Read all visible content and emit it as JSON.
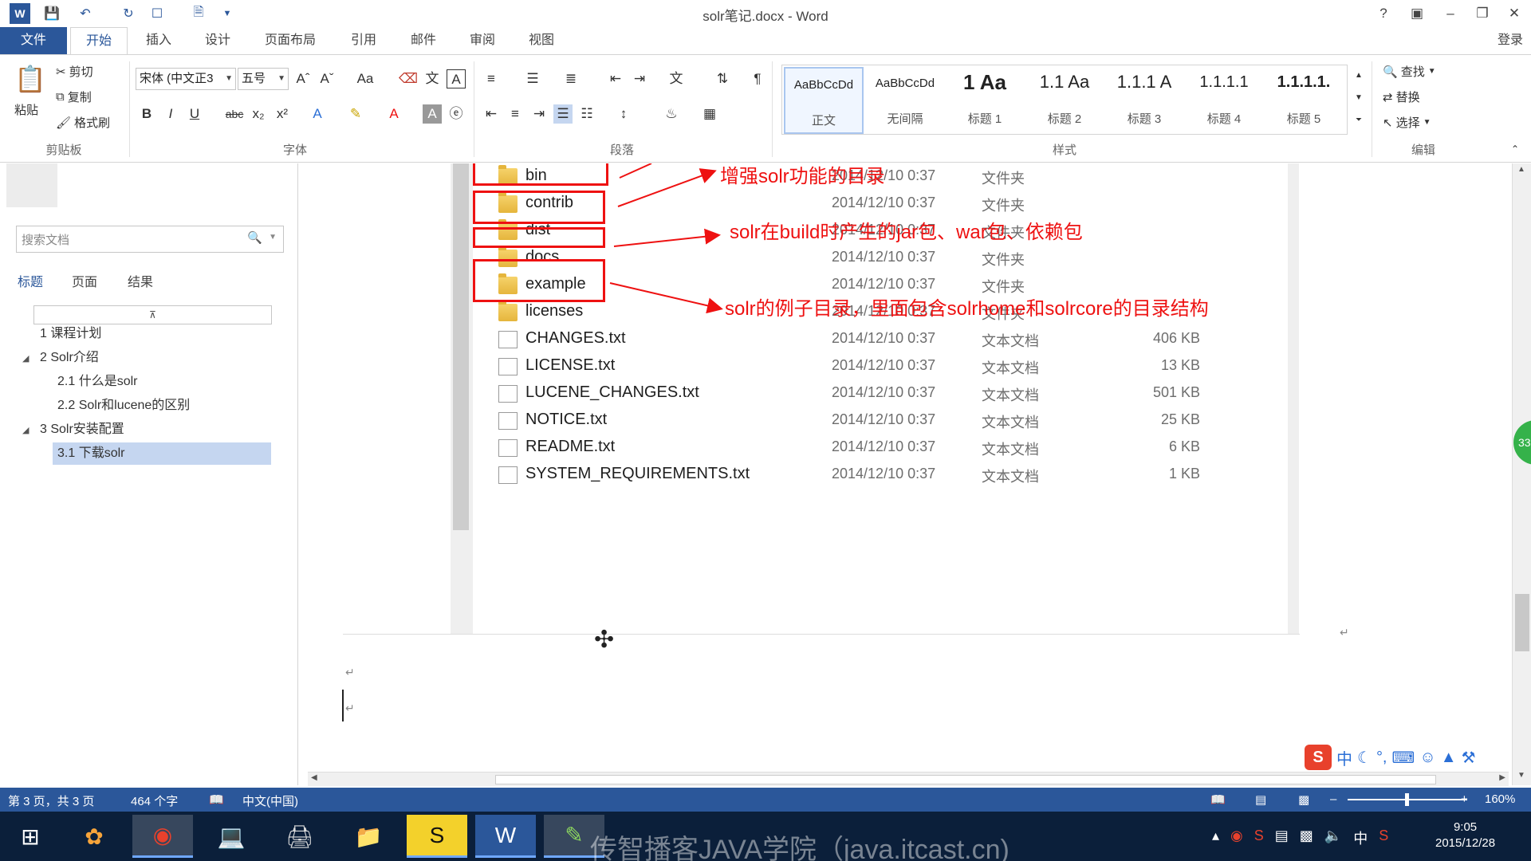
{
  "window": {
    "title": "solr笔记.docx - Word",
    "help": "?",
    "login": "登录"
  },
  "tabs": [
    {
      "label": "文件"
    },
    {
      "label": "开始"
    },
    {
      "label": "插入"
    },
    {
      "label": "设计"
    },
    {
      "label": "页面布局"
    },
    {
      "label": "引用"
    },
    {
      "label": "邮件"
    },
    {
      "label": "审阅"
    },
    {
      "label": "视图"
    }
  ],
  "ribbon": {
    "clipboard": {
      "paste": "粘贴",
      "cut": "剪切",
      "copy": "复制",
      "format_painter": "格式刷",
      "group": "剪贴板"
    },
    "font": {
      "name": "宋体 (中文正3",
      "size": "五号",
      "group": "字体"
    },
    "paragraph": {
      "group": "段落"
    },
    "styles": {
      "group": "样式",
      "items": [
        {
          "sample": "AaBbCcDd",
          "name": "正文"
        },
        {
          "sample": "AaBbCcDd",
          "name": "无间隔"
        },
        {
          "sample": "1  Aa",
          "name": "标题 1"
        },
        {
          "sample": "1.1  Aa",
          "name": "标题 2"
        },
        {
          "sample": "1.1.1 A",
          "name": "标题 3"
        },
        {
          "sample": "1.1.1.1",
          "name": "标题 4"
        },
        {
          "sample": "1.1.1.1.",
          "name": "标题 5"
        }
      ]
    },
    "editing": {
      "find": "查找",
      "replace": "替换",
      "select": "选择",
      "group": "编辑"
    }
  },
  "nav": {
    "search_placeholder": "搜索文档",
    "tabs": [
      "标题",
      "页面",
      "结果"
    ],
    "items": [
      {
        "label": "1 课程计划"
      },
      {
        "label": "2 Solr介绍"
      },
      {
        "label": "2.1 什么是solr"
      },
      {
        "label": "2.2 Solr和lucene的区别"
      },
      {
        "label": "3 Solr安装配置"
      },
      {
        "label": "3.1 下载solr"
      }
    ]
  },
  "files": [
    {
      "name": "bin",
      "date": "2014/12/10 0:37",
      "type": "文件夹",
      "size": ""
    },
    {
      "name": "contrib",
      "date": "2014/12/10 0:37",
      "type": "文件夹",
      "size": ""
    },
    {
      "name": "dist",
      "date": "2014/12/10 0:37",
      "type": "文件夹",
      "size": ""
    },
    {
      "name": "docs",
      "date": "2014/12/10 0:37",
      "type": "文件夹",
      "size": ""
    },
    {
      "name": "example",
      "date": "2014/12/10 0:37",
      "type": "文件夹",
      "size": ""
    },
    {
      "name": "licenses",
      "date": "2014/12/10 0:37",
      "type": "文件夹",
      "size": ""
    },
    {
      "name": "CHANGES.txt",
      "date": "2014/12/10 0:37",
      "type": "文本文档",
      "size": "406 KB"
    },
    {
      "name": "LICENSE.txt",
      "date": "2014/12/10 0:37",
      "type": "文本文档",
      "size": "13 KB"
    },
    {
      "name": "LUCENE_CHANGES.txt",
      "date": "2014/12/10 0:37",
      "type": "文本文档",
      "size": "501 KB"
    },
    {
      "name": "NOTICE.txt",
      "date": "2014/12/10 0:37",
      "type": "文本文档",
      "size": "25 KB"
    },
    {
      "name": "README.txt",
      "date": "2014/12/10 0:37",
      "type": "文本文档",
      "size": "6 KB"
    },
    {
      "name": "SYSTEM_REQUIREMENTS.txt",
      "date": "2014/12/10 0:37",
      "type": "文本文档",
      "size": "1 KB"
    }
  ],
  "annotations": [
    {
      "text": "增强solr功能的目录"
    },
    {
      "text": "solr在build时产生的jar包、war包、依赖包"
    },
    {
      "text": "solr的例子目录，里面包含solrhome和solrcore的目录结构"
    }
  ],
  "status": {
    "page": "第 3 页，共 3 页",
    "words": "464 个字",
    "language": "中文(中国)",
    "zoom": "160%"
  },
  "taskbar": {
    "watermark": "传智播客JAVA学院（java.itcast.cn)",
    "time": "9:05",
    "date": "2015/12/28",
    "ime": "中"
  },
  "colors": {
    "accent": "#2b579a",
    "annotation": "#ee1111"
  }
}
